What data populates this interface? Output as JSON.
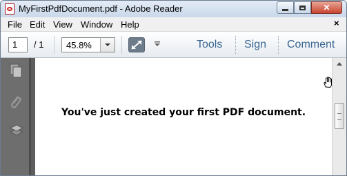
{
  "window": {
    "title": "MyFirstPdfDocument.pdf - Adobe Reader",
    "close_glyph": "✕"
  },
  "menu": {
    "items": [
      "File",
      "Edit",
      "View",
      "Window",
      "Help"
    ],
    "doc_close": "×"
  },
  "toolbar": {
    "page_current": "1",
    "page_total": "/ 1",
    "zoom": "45.8%",
    "tools_label": "Tools",
    "sign_label": "Sign",
    "comment_label": "Comment"
  },
  "document": {
    "text": "You've just created your first PDF document."
  },
  "colors": {
    "link": "#3a6591",
    "nav_pane": "#6e6e6e"
  }
}
